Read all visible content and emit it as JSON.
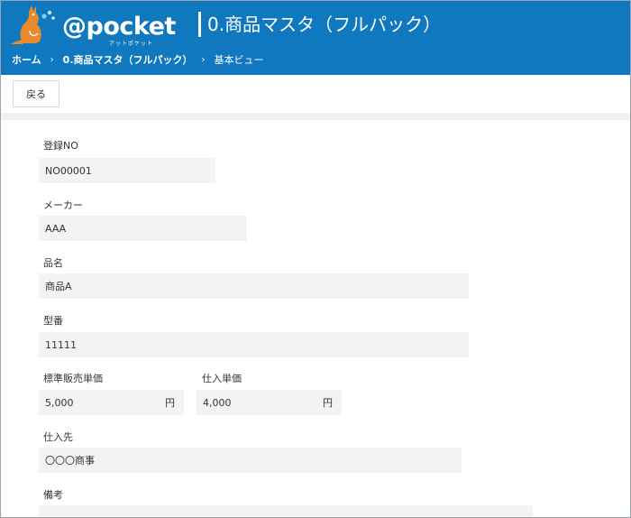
{
  "header": {
    "logo_text": "@pocket",
    "logo_sub": "アットポケット",
    "page_title": "0.商品マスタ（フルパック）"
  },
  "breadcrumb": [
    {
      "label": "ホーム"
    },
    {
      "label": "0.商品マスタ（フルパック）"
    },
    {
      "label": "基本ビュー"
    }
  ],
  "toolbar": {
    "back_label": "戻る"
  },
  "form": {
    "registration_no": {
      "label": "登録NO",
      "value": "NO00001"
    },
    "maker": {
      "label": "メーカー",
      "value": "AAA"
    },
    "product_name": {
      "label": "品名",
      "value": "商品A"
    },
    "model_no": {
      "label": "型番",
      "value": "11111"
    },
    "standard_price": {
      "label": "標準販売単価",
      "value": "5,000",
      "unit": "円"
    },
    "purchase_price": {
      "label": "仕入単価",
      "value": "4,000",
      "unit": "円"
    },
    "supplier": {
      "label": "仕入先",
      "value": "〇〇〇商事"
    },
    "remarks": {
      "label": "備考",
      "value": ""
    }
  },
  "colors": {
    "header_bg": "#0f78be",
    "logo_orange": "#e88a2d",
    "field_bg": "#f3f3f3"
  }
}
